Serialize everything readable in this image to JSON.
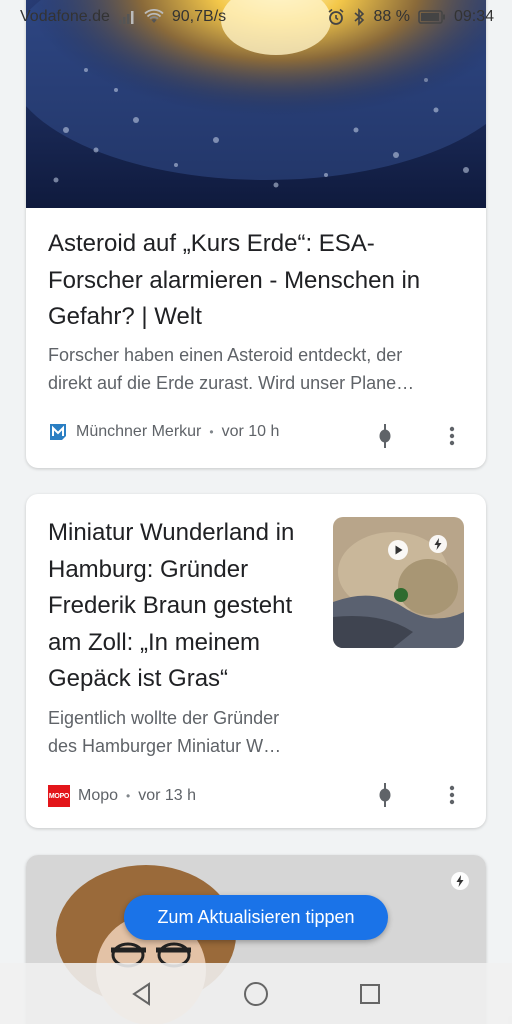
{
  "status_bar": {
    "carrier": "Vodafone.de",
    "net_speed": "90,7B/s",
    "battery_percent": "88 %",
    "time": "09:34",
    "icons": [
      "signal-icon",
      "wifi-icon",
      "alarm-icon",
      "bluetooth-icon",
      "battery-icon"
    ]
  },
  "cards": [
    {
      "title": "Asteroid auf „Kurs Erde“: ESA-Forscher alarmieren - Menschen in Gefahr? | Welt",
      "snippet_line1": "Forscher haben einen Asteroid entdeckt, der",
      "snippet_line2": "direkt auf die Erde zurast. Wird unser Plane…",
      "source": "Münchner Merkur",
      "time": "vor 10 h",
      "separator": "•"
    },
    {
      "title": "Miniatur Wunderland in Hamburg: Gründer Frederik Braun gesteht am Zoll: „In meinem Gepäck ist Gras“",
      "snippet_line1": "Eigentlich wollte der Gründer",
      "snippet_line2": "des Hamburger Miniatur W…",
      "source": "Mopo",
      "source_logo_text": "MOPO",
      "time": "vor 13 h",
      "separator": "•"
    }
  ],
  "refresh_button": "Zum Aktualisieren tippen",
  "colors": {
    "accent": "#1a73e8",
    "background": "#f1f3f4",
    "title_text": "#202124",
    "secondary_text": "#5f6368",
    "mopo_red": "#e3151a"
  }
}
